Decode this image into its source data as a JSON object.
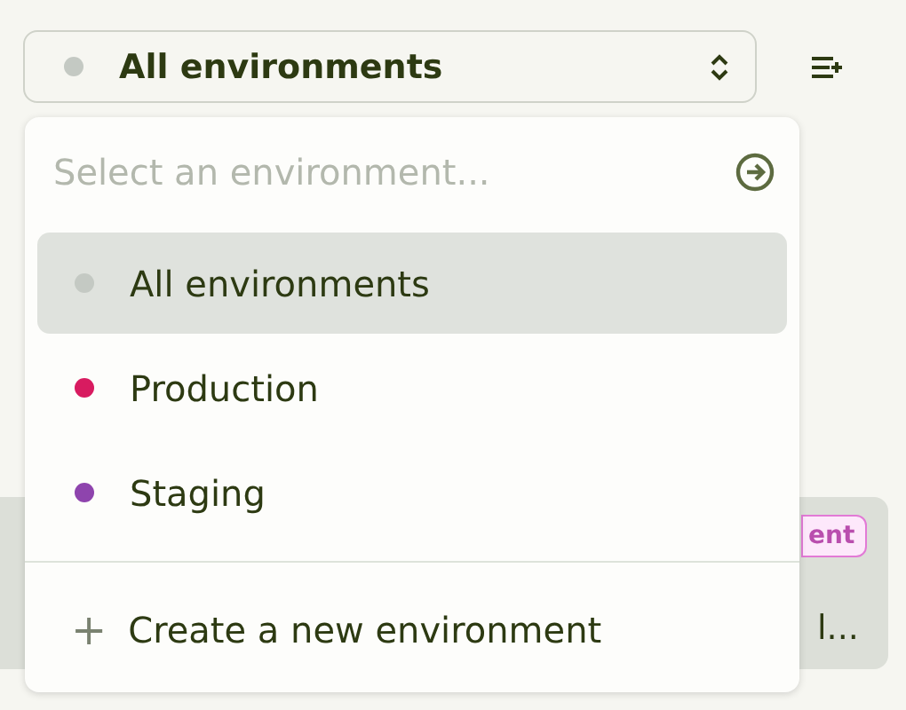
{
  "environment_select": {
    "value": "All environments",
    "color": "#c4c9c3"
  },
  "background_card": {
    "badge": "ent",
    "text": "l..."
  },
  "dropdown": {
    "search": {
      "placeholder": "Select an environment..."
    },
    "options": [
      {
        "label": "All environments",
        "color": "#c4c9c3",
        "selected": true
      },
      {
        "label": "Production",
        "color": "#d81b60",
        "selected": false
      },
      {
        "label": "Staging",
        "color": "#8e44ad",
        "selected": false
      }
    ],
    "create_action": {
      "icon": "+",
      "label": "Create a new environment"
    }
  }
}
